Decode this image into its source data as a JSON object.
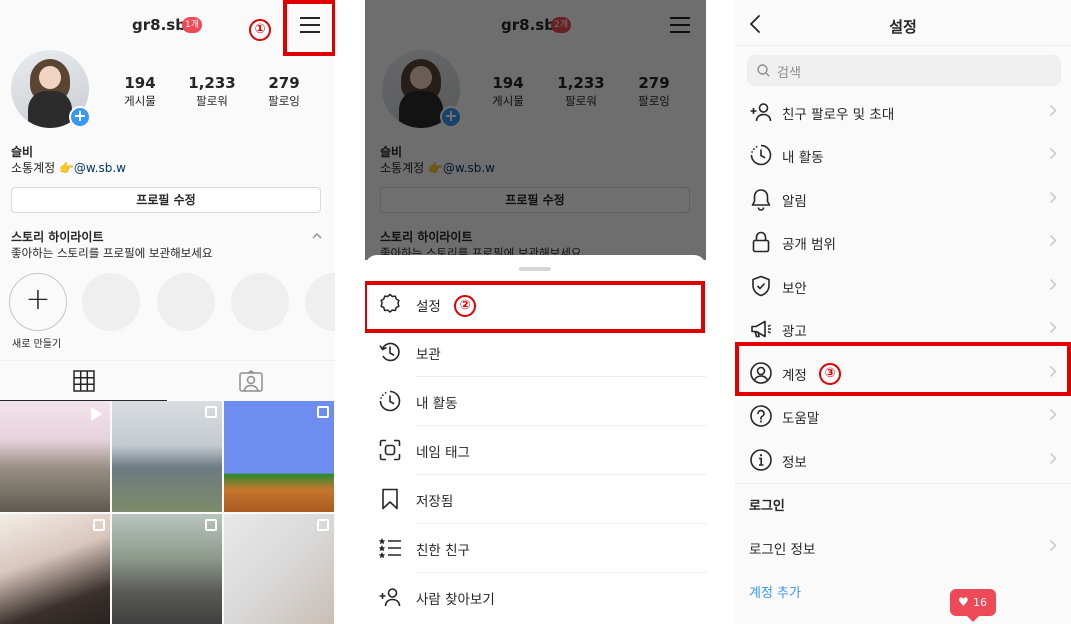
{
  "profile": {
    "username": "gr8.sb",
    "notif_badge": "1개",
    "notif_badge_dim": "2개",
    "stats": [
      {
        "num": "194",
        "label": "게시물"
      },
      {
        "num": "1,233",
        "label": "팔로워"
      },
      {
        "num": "279",
        "label": "팔로잉"
      }
    ],
    "name": "슬비",
    "bio_prefix": "소통계정 👉",
    "bio_mention": "@w.sb.w",
    "edit_button": "프로필 수정",
    "highlights_title": "스토리 하이라이트",
    "highlights_sub": "좋아하는 스토리를 프로필에 보관해보세요",
    "new_highlight_label": "새로 만들기"
  },
  "steps": [
    "①",
    "②",
    "③"
  ],
  "menu": {
    "items": [
      {
        "label": "설정",
        "icon": "gear-icon"
      },
      {
        "label": "보관",
        "icon": "archive-icon"
      },
      {
        "label": "내 활동",
        "icon": "activity-icon"
      },
      {
        "label": "네임 태그",
        "icon": "nametag-icon"
      },
      {
        "label": "저장됨",
        "icon": "bookmark-icon"
      },
      {
        "label": "친한 친구",
        "icon": "close-friends-icon"
      },
      {
        "label": "사람 찾아보기",
        "icon": "discover-people-icon"
      }
    ]
  },
  "settings": {
    "title": "설정",
    "search_placeholder": "검색",
    "items": [
      {
        "label": "친구 팔로우 및 초대",
        "icon": "add-person-icon"
      },
      {
        "label": "내 활동",
        "icon": "activity-icon"
      },
      {
        "label": "알림",
        "icon": "bell-icon"
      },
      {
        "label": "공개 범위",
        "icon": "lock-icon"
      },
      {
        "label": "보안",
        "icon": "shield-icon"
      },
      {
        "label": "광고",
        "icon": "megaphone-icon"
      },
      {
        "label": "계정",
        "icon": "account-icon"
      },
      {
        "label": "도움말",
        "icon": "help-icon"
      },
      {
        "label": "정보",
        "icon": "info-icon"
      }
    ],
    "login_section": "로그인",
    "login_info": "로그인 정보",
    "add_account": "계정 추가",
    "like_count": "16"
  },
  "colors": {
    "annotation_red": "#e00000",
    "link_blue": "#3897f0",
    "badge_red": "#ed4956"
  }
}
